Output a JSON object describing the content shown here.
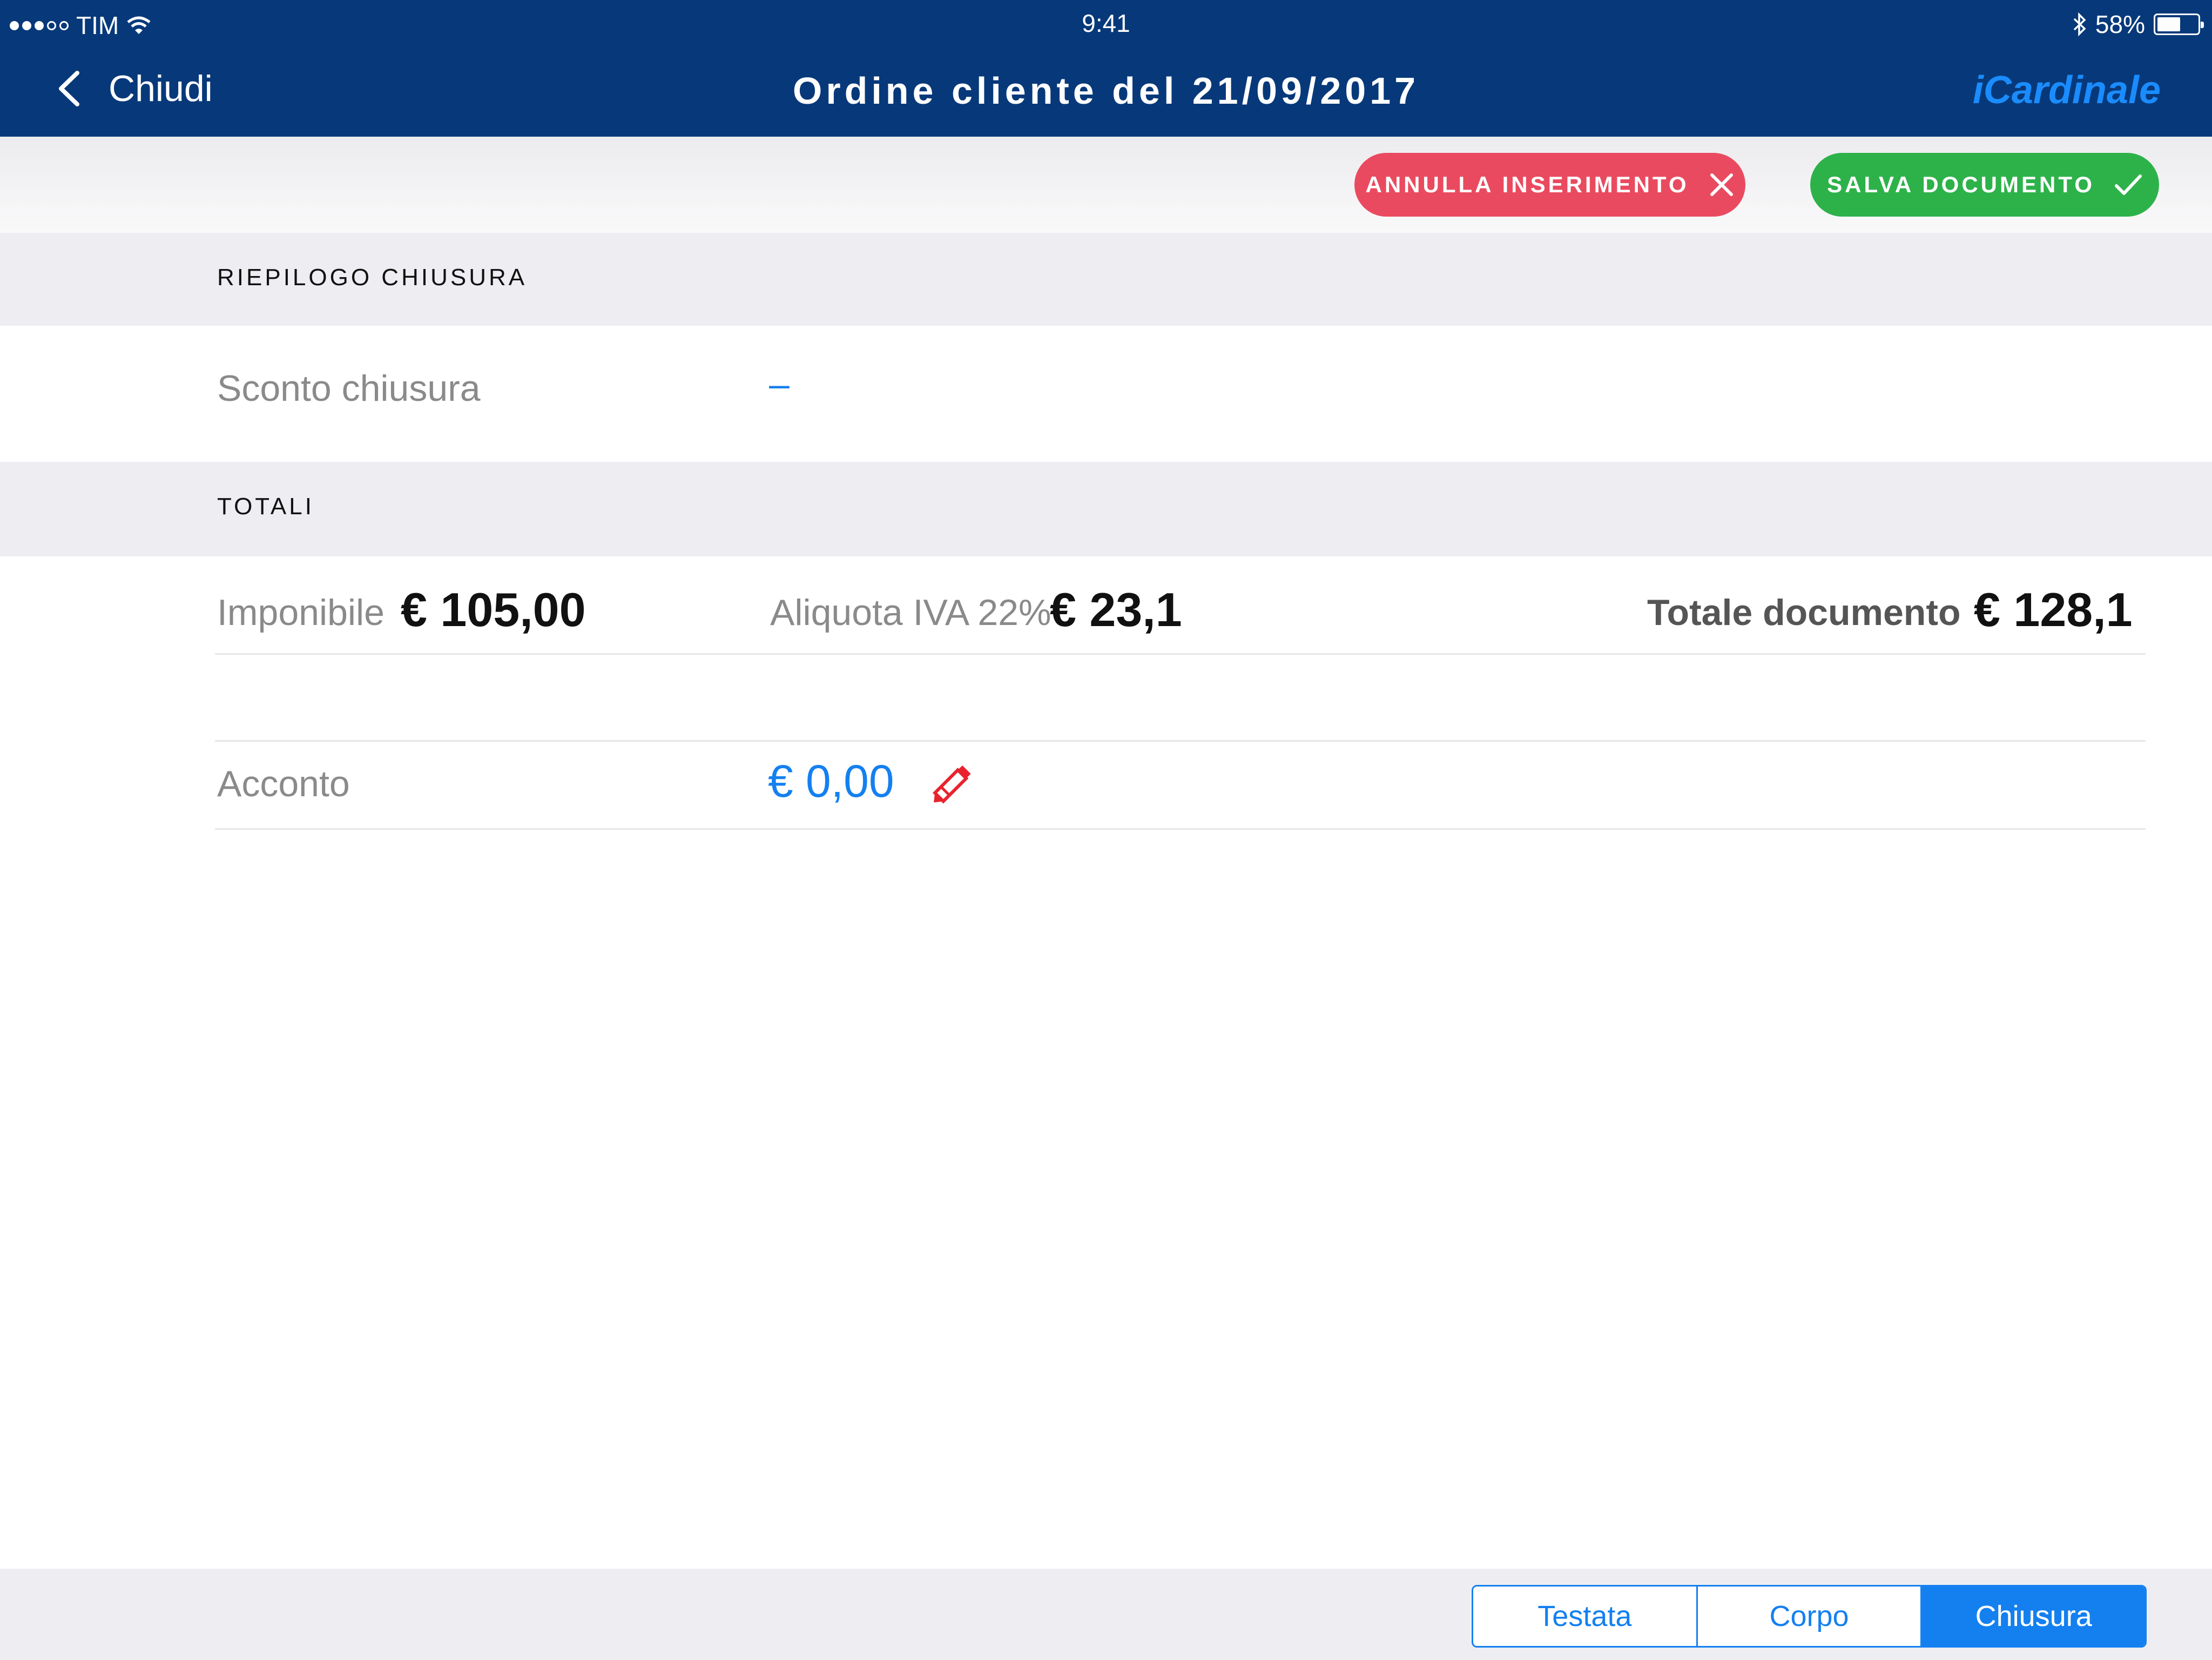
{
  "status_bar": {
    "carrier": "TIM",
    "time": "9:41",
    "battery": "58%",
    "battery_level": 0.58
  },
  "nav": {
    "back_label": "Chiudi",
    "title": "Ordine cliente del 21/09/2017",
    "brand": "iCardinale"
  },
  "actions": {
    "cancel_label": "ANNULLA INSERIMENTO",
    "save_label": "SALVA DOCUMENTO"
  },
  "riepilogo": {
    "header": "RIEPILOGO CHIUSURA",
    "sconto_label": "Sconto chiusura",
    "sconto_value": "–"
  },
  "totali": {
    "header": "TOTALI",
    "imponibile_label": "Imponibile",
    "imponibile_value": "€ 105,00",
    "iva_label": "Aliquota IVA 22%",
    "iva_value": "€ 23,1",
    "totale_label": "Totale documento",
    "totale_value": "€ 128,1",
    "acconto_label": "Acconto",
    "acconto_value": "€ 0,00"
  },
  "tabs": [
    {
      "label": "Testata",
      "active": false
    },
    {
      "label": "Corpo",
      "active": false
    },
    {
      "label": "Chiusura",
      "active": true
    }
  ],
  "colors": {
    "nav_bg": "#07397a",
    "accent": "#1480f0",
    "cancel": "#ea4a5f",
    "save": "#2db24a",
    "edit_icon": "#e8232e"
  }
}
